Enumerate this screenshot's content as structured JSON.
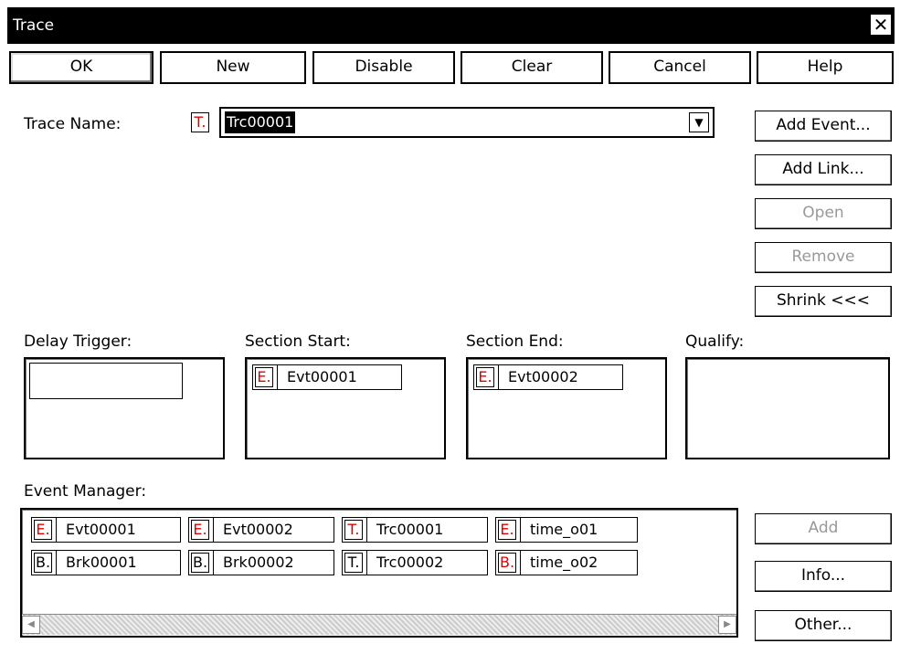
{
  "window": {
    "title": "Trace"
  },
  "toolbar": {
    "ok": "OK",
    "new": "New",
    "disable": "Disable",
    "clear": "Clear",
    "cancel": "Cancel",
    "help": "Help"
  },
  "trace_name": {
    "label": "Trace Name:",
    "prefix": "T.",
    "value": "Trc00001"
  },
  "side_buttons": {
    "add_event": "Add Event...",
    "add_link": "Add Link...",
    "open": "Open",
    "remove": "Remove",
    "shrink": "Shrink <<<"
  },
  "sections": {
    "delay_trigger": {
      "label": "Delay Trigger:"
    },
    "section_start": {
      "label": "Section Start:",
      "item": {
        "prefix": "E.",
        "name": "Evt00001"
      }
    },
    "section_end": {
      "label": "Section End:",
      "item": {
        "prefix": "E.",
        "name": "Evt00002"
      }
    },
    "qualify": {
      "label": "Qualify:"
    }
  },
  "event_manager": {
    "label": "Event Manager:",
    "row1": [
      {
        "prefix": "E.",
        "name": "Evt00001"
      },
      {
        "prefix": "E.",
        "name": "Evt00002"
      },
      {
        "prefix": "T.",
        "name": "Trc00001"
      },
      {
        "prefix": "E.",
        "name": "time_o01"
      }
    ],
    "row2": [
      {
        "prefix": "B.",
        "name": "Brk00001"
      },
      {
        "prefix": "B.",
        "name": "Brk00002"
      },
      {
        "prefix": "T.",
        "name": "Trc00002"
      },
      {
        "prefix": "B.",
        "name": "time_o02"
      }
    ],
    "add": "Add",
    "info": "Info...",
    "other": "Other..."
  }
}
